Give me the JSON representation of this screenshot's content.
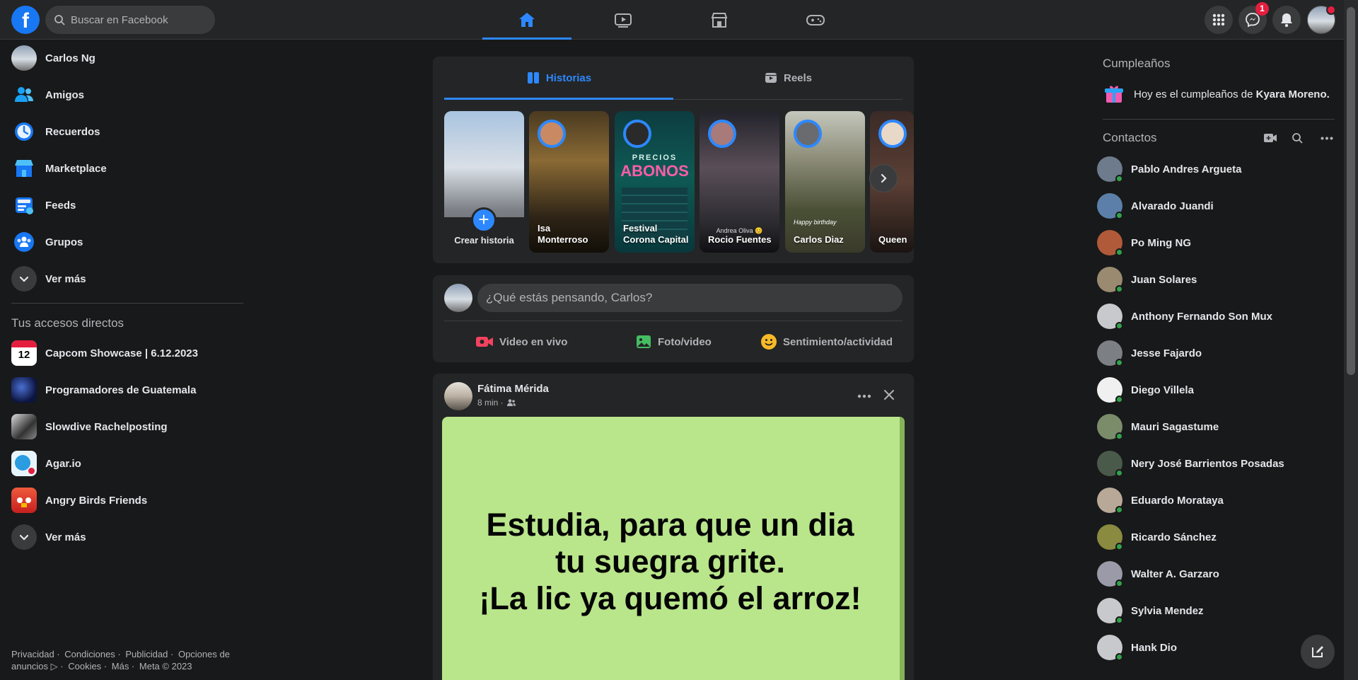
{
  "header": {
    "logo_letter": "f",
    "search_placeholder": "Buscar en Facebook",
    "nav_tabs": [
      "home-icon",
      "watch-icon",
      "marketplace-icon",
      "gaming-icon"
    ],
    "messenger_badge": "1"
  },
  "left_sidebar": {
    "items": [
      {
        "label": "Carlos Ng",
        "icon": "profile-avatar"
      },
      {
        "label": "Amigos",
        "icon": "friends-icon"
      },
      {
        "label": "Recuerdos",
        "icon": "memories-clock-icon"
      },
      {
        "label": "Marketplace",
        "icon": "marketplace-icon"
      },
      {
        "label": "Feeds",
        "icon": "feeds-icon"
      },
      {
        "label": "Grupos",
        "icon": "groups-icon"
      },
      {
        "label": "Ver más",
        "icon": "chevron-down-icon"
      }
    ],
    "shortcuts_title": "Tus accesos directos",
    "shortcuts": [
      {
        "label": "Capcom Showcase | 6.12.2023",
        "icon_text": "12"
      },
      {
        "label": "Programadores de Guatemala"
      },
      {
        "label": "Slowdive Rachelposting"
      },
      {
        "label": "Agar.io"
      },
      {
        "label": "Angry Birds Friends"
      },
      {
        "label": "Ver más"
      }
    ],
    "footer": [
      "Privacidad ·",
      "Condiciones ·",
      "Publicidad ·",
      "Opciones de anuncios ▷ ·",
      "Cookies ·",
      "Más ·",
      "Meta © 2023"
    ]
  },
  "stories": {
    "tabs": [
      "Historias",
      "Reels"
    ],
    "create_label": "Crear historia",
    "items": [
      {
        "name": "Isa Monterroso"
      },
      {
        "name": "Festival Corona Capital",
        "overlay_top": "PRECIOS",
        "overlay_main": "ABONOS"
      },
      {
        "name": "Rocio Fuentes",
        "overlay": "Andrea Oliva 😊"
      },
      {
        "name": "Carlos Diaz",
        "overlay": "Happy birthday"
      },
      {
        "name": "Queen"
      }
    ]
  },
  "composer": {
    "placeholder": "¿Qué estás pensando, Carlos?",
    "actions": [
      "Video en vivo",
      "Foto/video",
      "Sentimiento/actividad"
    ]
  },
  "post": {
    "author": "Fátima Mérida",
    "meta": "8 min ·",
    "text_lines": [
      "Estudia, para que un dia",
      "tu suegra grite.",
      "¡La lic ya quemó el arroz!"
    ],
    "background_color": "#b9e58b"
  },
  "right_sidebar": {
    "birthdays_title": "Cumpleaños",
    "birthday_prefix": "Hoy es el cumpleaños de ",
    "birthday_name": "Kyara Moreno.",
    "contacts_title": "Contactos",
    "contacts": [
      "Pablo Andres Argueta",
      "Alvarado Juandi",
      "Po Ming NG",
      "Juan Solares",
      "Anthony Fernando Son Mux",
      "Jesse Fajardo",
      "Diego Villela",
      "Mauri Sagastume",
      "Nery José Barrientos Posadas",
      "Eduardo Morataya",
      "Ricardo Sánchez",
      "Walter A. Garzaro",
      "Sylvia Mendez",
      "Hank Dio"
    ]
  },
  "colors": {
    "accent": "#2d88ff",
    "background": "#18191a",
    "surface": "#242526",
    "online": "#31a24c",
    "badge": "#e41e3f"
  }
}
